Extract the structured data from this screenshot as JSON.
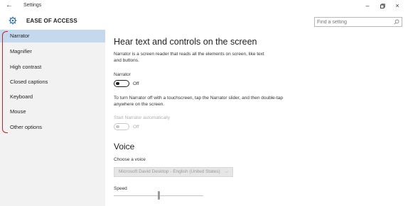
{
  "window": {
    "back_glyph": "←",
    "title": "Settings",
    "minimize_glyph": "–",
    "maximize_glyph": "▫",
    "close_glyph": "×"
  },
  "header": {
    "icon": "ease-of-access-gear-icon",
    "title": "EASE OF ACCESS"
  },
  "search": {
    "placeholder": "Find a setting",
    "icon": "search-icon"
  },
  "sidebar": {
    "items": [
      {
        "label": "Narrator",
        "active": true
      },
      {
        "label": "Magnifier",
        "active": false
      },
      {
        "label": "High contrast",
        "active": false
      },
      {
        "label": "Closed captions",
        "active": false
      },
      {
        "label": "Keyboard",
        "active": false
      },
      {
        "label": "Mouse",
        "active": false
      },
      {
        "label": "Other options",
        "active": false
      }
    ],
    "active_color": "#c5d9ee",
    "annotation_color": "#c0241e"
  },
  "main": {
    "heading": "Hear text and controls on the screen",
    "description": "Narrator is a screen reader that reads all the elements on screen, like text and buttons.",
    "narrator": {
      "label": "Narrator",
      "state": "Off"
    },
    "touch_hint": "To turn Narrator off with a touchscreen, tap the Narrator slider, and then double-tap anywhere on the screen.",
    "auto_start": {
      "label": "Start Narrator automatically",
      "state": "Off"
    },
    "voice_heading": "Voice",
    "choose_voice_label": "Choose a voice",
    "voice_value": "Microsoft David Desktop - English (United States)",
    "speed_label": "Speed",
    "speed_level": 0.5
  }
}
